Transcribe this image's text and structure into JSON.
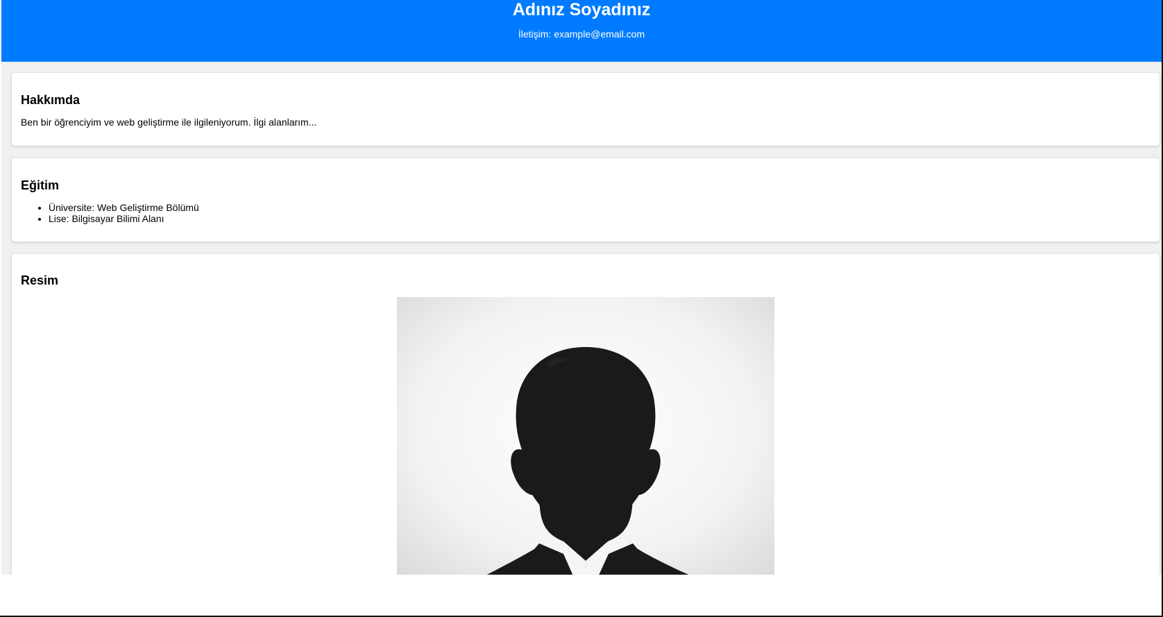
{
  "header": {
    "name": "Adınız Soyadınız",
    "contact": "İletişim: example@email.com",
    "background_color": "#007bff"
  },
  "sections": {
    "about": {
      "title": "Hakkımda",
      "text": "Ben bir öğrenciyim ve web geliştirme ile ilgileniyorum. İlgi alanlarım..."
    },
    "education": {
      "title": "Eğitim",
      "items": [
        "Üniversite: Web Geliştirme Bölümü",
        "Lise: Bilgisayar Bilimi Alanı"
      ]
    },
    "image": {
      "title": "Resim",
      "alt": "profile-silhouette"
    }
  },
  "colors": {
    "page_background": "#f0f0f0",
    "card_background": "#ffffff",
    "silhouette": "#1a1a1a",
    "tie": "#a01010"
  }
}
